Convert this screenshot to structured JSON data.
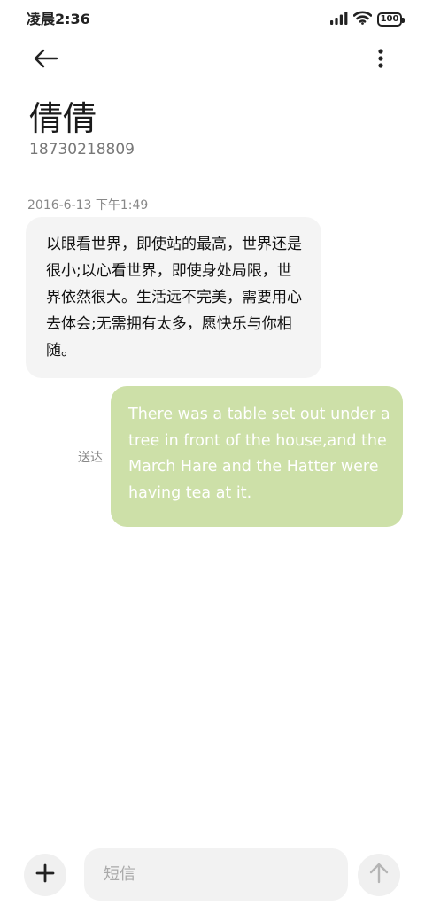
{
  "status_bar": {
    "time": "凌晨2:36",
    "battery": "100",
    "icons": [
      "signal-icon",
      "wifi-icon",
      "battery-icon"
    ]
  },
  "header": {
    "back_icon": "arrow-left-icon",
    "more_icon": "more-vertical-icon"
  },
  "contact": {
    "name": "倩倩",
    "number": "18730218809"
  },
  "conversation": {
    "timestamp": "2016-6-13 下午1:49",
    "incoming_message": "以眼看世界，即使站的最高，世界还是很小;以心看世界，即使身处局限，世界依然很大。生活远不完美，需要用心去体会;无需拥有太多，愿快乐与你相随。",
    "outgoing_message": "There was a table set out under a tree in front of the house,and the March Hare and the Hatter were having tea at it.",
    "outgoing_status": "送达"
  },
  "composer": {
    "placeholder": "短信",
    "add_icon": "plus-icon",
    "send_icon": "arrow-up-icon"
  },
  "colors": {
    "outgoing_bubble": "#cde0a8",
    "incoming_bubble": "#f4f4f4",
    "outgoing_text": "#ffffff"
  }
}
